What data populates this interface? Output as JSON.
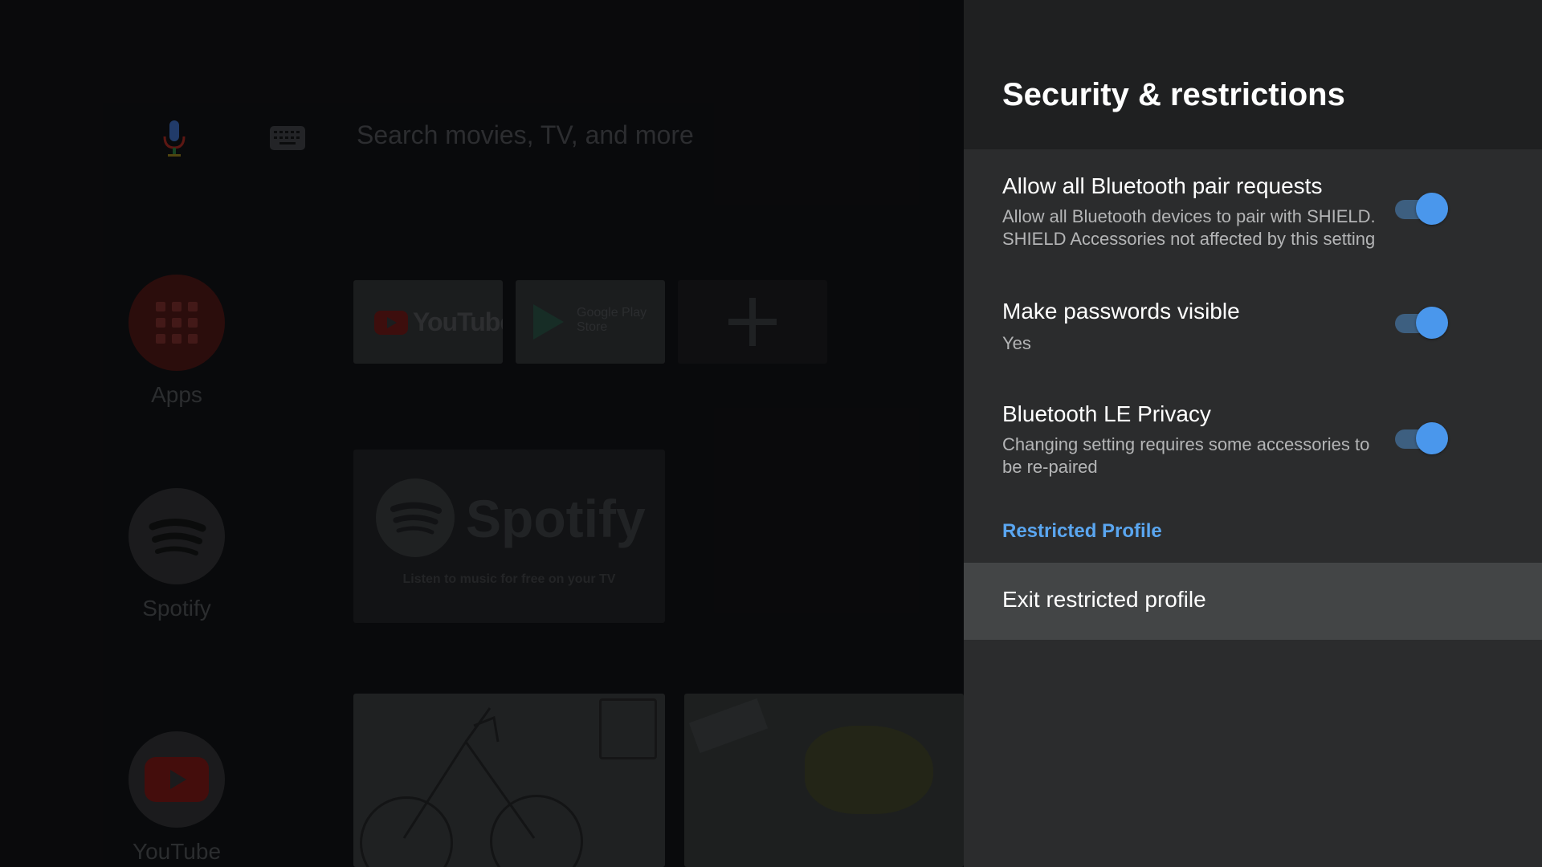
{
  "home": {
    "search_placeholder": "Search movies, TV, and more",
    "rail": [
      {
        "label": "Apps",
        "icon": "apps-grid-icon"
      },
      {
        "label": "Spotify",
        "icon": "spotify-icon"
      },
      {
        "label": "YouTube",
        "icon": "youtube-icon"
      }
    ],
    "favorites": [
      {
        "label": "YouTube",
        "icon": "youtube-logo"
      },
      {
        "label": "Google Play Store",
        "line1": "Google Play",
        "line2": "Store",
        "icon": "google-play-icon"
      },
      {
        "label": "",
        "icon": "plus-icon"
      }
    ],
    "spotify_card": {
      "wordmark": "Spotify",
      "tagline": "Listen to music for free on your TV"
    }
  },
  "panel": {
    "title": "Security & restrictions",
    "settings": [
      {
        "title": "Allow all Bluetooth pair requests",
        "desc_lines": [
          "Allow all Bluetooth devices to pair with SHIELD.",
          "SHIELD Accessories not affected by this setting"
        ],
        "enabled": true
      },
      {
        "title": "Make passwords visible",
        "desc_lines": [
          "Yes"
        ],
        "enabled": true
      },
      {
        "title": "Bluetooth LE Privacy",
        "desc_lines": [
          "Changing setting requires some accessories to",
          "be re-paired"
        ],
        "enabled": true
      }
    ],
    "section_header": "Restricted Profile",
    "action": "Exit restricted profile",
    "accent_color": "#5aa6f0",
    "toggle_on_color": "#4a97ec"
  }
}
